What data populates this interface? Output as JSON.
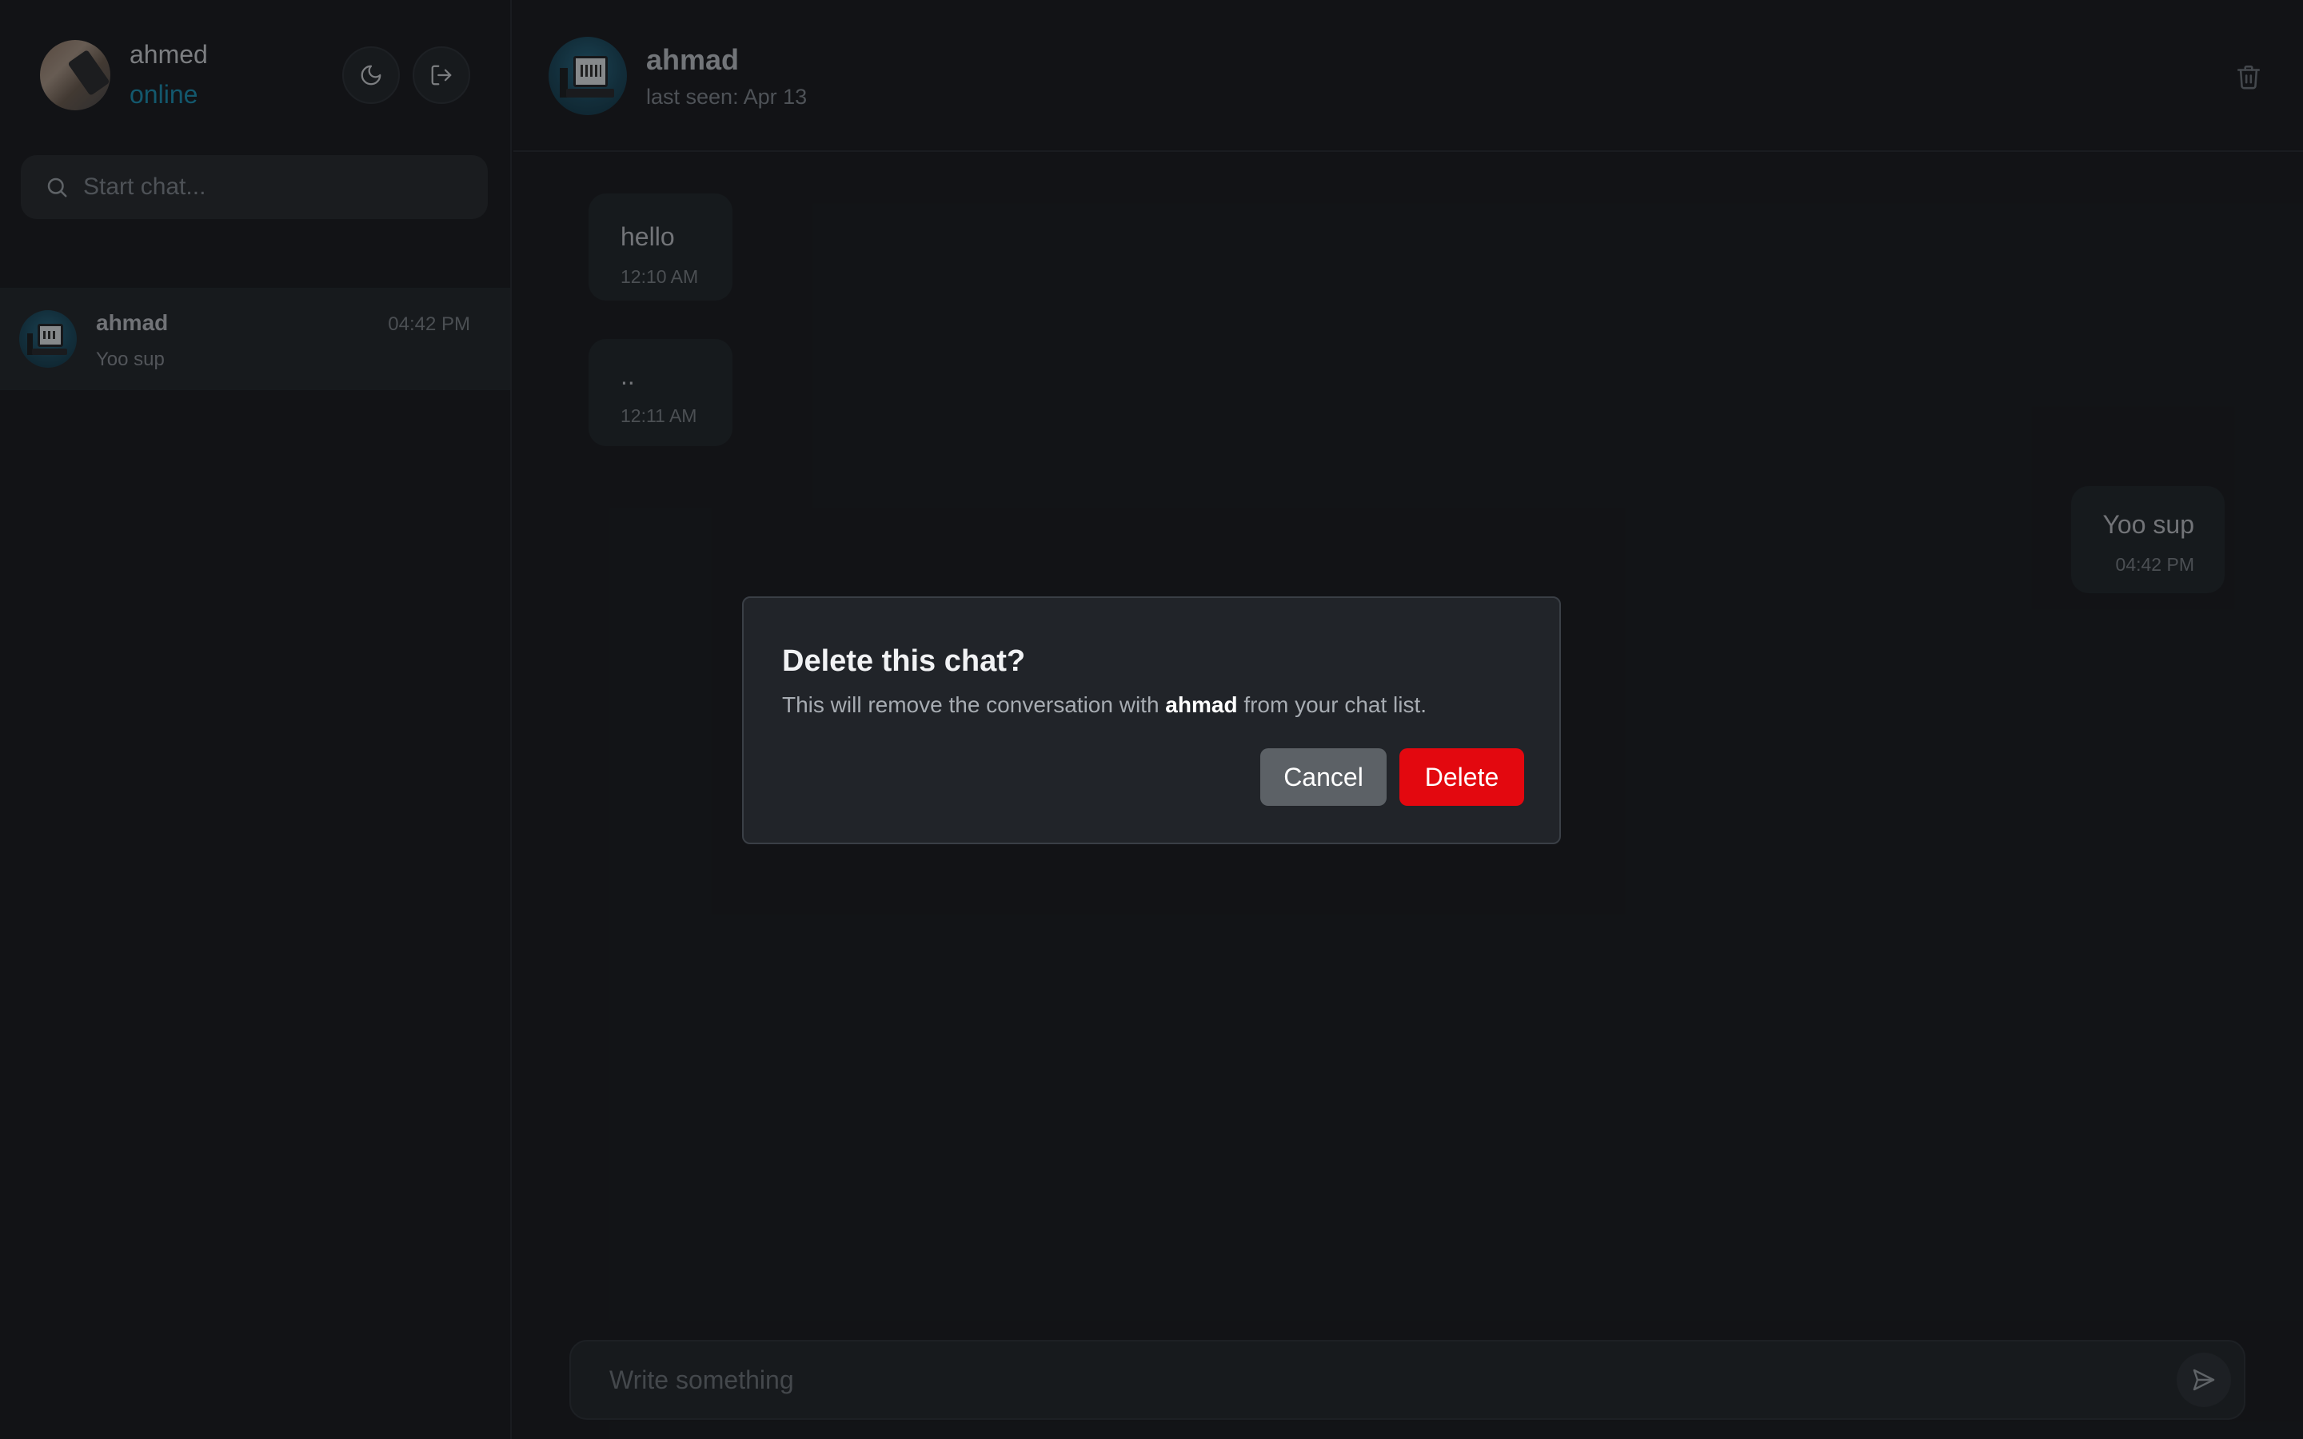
{
  "user": {
    "name": "ahmed",
    "status": "online",
    "status_color": "#1f8fb1"
  },
  "sidebar": {
    "search_placeholder": "Start chat...",
    "theme_toggle_icon": "moon-icon",
    "logout_icon": "logout-icon",
    "chats": [
      {
        "name": "ahmad",
        "time": "04:42 PM",
        "preview": "Yoo sup"
      }
    ]
  },
  "conversation": {
    "contact_name": "ahmad",
    "last_seen": "last seen: Apr 13",
    "delete_icon": "trash-icon",
    "messages": [
      {
        "text": "hello",
        "time": "12:10 AM",
        "direction": "incoming"
      },
      {
        "text": "..",
        "time": "12:11 AM",
        "direction": "incoming"
      },
      {
        "text": "Yoo sup",
        "time": "04:42 PM",
        "direction": "outgoing"
      }
    ],
    "composer_placeholder": "Write something",
    "send_icon": "send-icon"
  },
  "dialog": {
    "title": "Delete this chat?",
    "body_prefix": "This will remove the conversation with ",
    "body_name": "ahmad",
    "body_suffix": " from your chat list.",
    "cancel_label": "Cancel",
    "delete_label": "Delete",
    "delete_color": "#e3080f"
  }
}
